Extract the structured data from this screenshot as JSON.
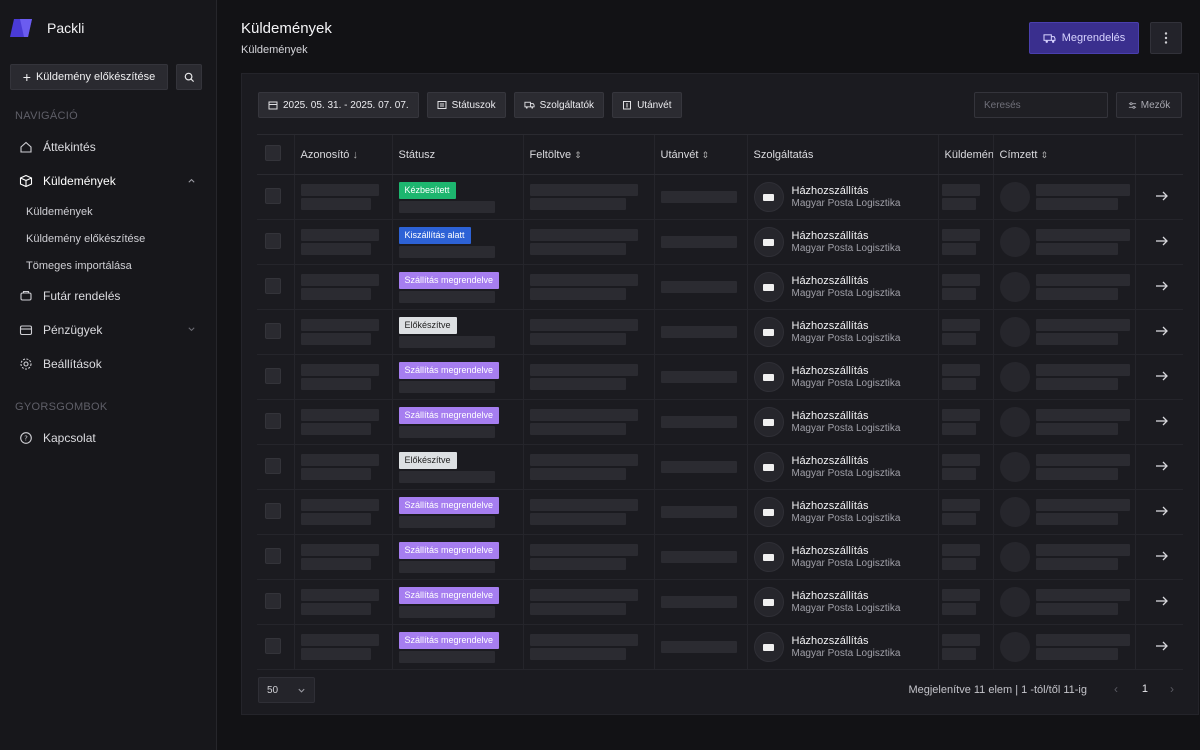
{
  "brand": {
    "name": "Packli"
  },
  "sidebar": {
    "create_label": "Küldemény előkészítése",
    "nav_section": "NAVIGÁCIÓ",
    "items": [
      {
        "label": "Áttekintés",
        "icon": "home-icon"
      },
      {
        "label": "Küldemények",
        "icon": "package-icon",
        "expanded": true,
        "subitems": [
          "Küldemények",
          "Küldemény előkészítése",
          "Tömeges importálása"
        ]
      },
      {
        "label": "Futár rendelés",
        "icon": "truck-icon"
      },
      {
        "label": "Pénzügyek",
        "icon": "wallet-icon",
        "collapsible": true
      },
      {
        "label": "Beállítások",
        "icon": "gear-icon"
      }
    ],
    "quick_section": "GYORSGOMBOK",
    "quick_items": [
      {
        "label": "Kapcsolat",
        "icon": "help-icon"
      }
    ]
  },
  "header": {
    "title": "Küldemények",
    "breadcrumb": "Küldemények",
    "order_button": "Megrendelés"
  },
  "filters": {
    "date_range": "2025. 05. 31. - 2025. 07. 07.",
    "statuses": "Státuszok",
    "providers": "Szolgáltatók",
    "cod": "Utánvét",
    "search_placeholder": "Keresés",
    "fields": "Mezők"
  },
  "table": {
    "columns": [
      "Azonosító",
      "Státusz",
      "Feltöltve",
      "Utánvét",
      "Szolgáltatás",
      "Küldemény",
      "Címzett"
    ],
    "rows": [
      {
        "status": "Kézbesített",
        "service": "Házhozszállítás",
        "provider": "Magyar Posta Logisztika"
      },
      {
        "status": "Kiszállítás alatt",
        "service": "Házhozszállítás",
        "provider": "Magyar Posta Logisztika"
      },
      {
        "status": "Szállítás megrendelve",
        "service": "Házhozszállítás",
        "provider": "Magyar Posta Logisztika"
      },
      {
        "status": "Előkészítve",
        "service": "Házhozszállítás",
        "provider": "Magyar Posta Logisztika"
      },
      {
        "status": "Szállítás megrendelve",
        "service": "Házhozszállítás",
        "provider": "Magyar Posta Logisztika"
      },
      {
        "status": "Szállítás megrendelve",
        "service": "Házhozszállítás",
        "provider": "Magyar Posta Logisztika"
      },
      {
        "status": "Előkészítve",
        "service": "Házhozszállítás",
        "provider": "Magyar Posta Logisztika"
      },
      {
        "status": "Szállítás megrendelve",
        "service": "Házhozszállítás",
        "provider": "Magyar Posta Logisztika"
      },
      {
        "status": "Szállítás megrendelve",
        "service": "Házhozszállítás",
        "provider": "Magyar Posta Logisztika"
      },
      {
        "status": "Szállítás megrendelve",
        "service": "Házhozszállítás",
        "provider": "Magyar Posta Logisztika"
      },
      {
        "status": "Szállítás megrendelve",
        "service": "Házhozszállítás",
        "provider": "Magyar Posta Logisztika"
      }
    ]
  },
  "status_colors": {
    "Kézbesített": {
      "bg": "#1db66f",
      "fg": "#ffffff"
    },
    "Kiszállítás alatt": {
      "bg": "#2d62d6",
      "fg": "#ffffff"
    },
    "Szállítás megrendelve": {
      "bg": "#a67ef0",
      "fg": "#ffffff"
    },
    "Előkészítve": {
      "bg": "#dde0e3",
      "fg": "#222222"
    }
  },
  "pagination": {
    "per_page": "50",
    "info": "Megjelenítve 11 elem | 1 -tól/től 11-ig",
    "current_page": "1"
  },
  "colors": {
    "accent": "#3a2f8e",
    "background": "#121215",
    "sidebar": "#17171b"
  }
}
